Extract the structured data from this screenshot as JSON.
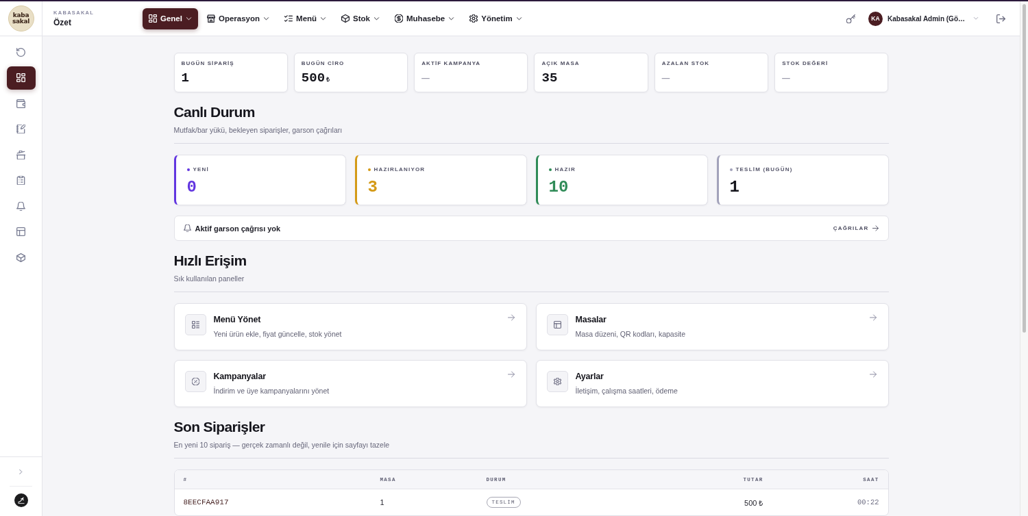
{
  "sidebar": {
    "logo": {
      "lines": [
        "kaba",
        "sakal"
      ]
    },
    "items": [
      {
        "selected": false
      },
      {
        "selected": true
      },
      {
        "selected": false
      },
      {
        "selected": false
      },
      {
        "selected": false
      },
      {
        "selected": false
      },
      {
        "selected": false
      },
      {
        "selected": false
      },
      {
        "selected": false
      }
    ]
  },
  "topbar": {
    "breadcrumb": {
      "section": "KABASAKAL",
      "page": "Özet"
    },
    "nav": [
      {
        "label": "Genel",
        "selected": true
      },
      {
        "label": "Operasyon",
        "selected": false
      },
      {
        "label": "Menü",
        "selected": false
      },
      {
        "label": "Stok",
        "selected": false
      },
      {
        "label": "Muhasebe",
        "selected": false
      },
      {
        "label": "Yönetim",
        "selected": false
      }
    ],
    "user": {
      "initials": "KA",
      "name": "Kabasakal Admin (Gö…"
    }
  },
  "stats": [
    {
      "label": "BUGÜN SİPARİŞ",
      "value": "1",
      "kind": "number"
    },
    {
      "label": "BUGÜN CİRO",
      "value": "500",
      "unit": "₺",
      "kind": "number"
    },
    {
      "label": "AKTİF KAMPANYA",
      "value": "—",
      "kind": "empty"
    },
    {
      "label": "AÇIK MASA",
      "value": "35",
      "kind": "number"
    },
    {
      "label": "AZALAN STOK",
      "value": "—",
      "kind": "empty"
    },
    {
      "label": "STOK DEĞERİ",
      "value": "—",
      "kind": "empty"
    }
  ],
  "live": {
    "title": "Canlı Durum",
    "subtitle": "Mutfak/bar yükü, bekleyen siparişler, garson çağrıları",
    "cards": [
      {
        "label": "YENİ",
        "value": "0",
        "color": "#6236e0",
        "kind": "accent"
      },
      {
        "label": "HAZIRLANIYOR",
        "value": "3",
        "color": "#d49a17",
        "kind": "accent"
      },
      {
        "label": "HAZIR",
        "value": "10",
        "color": "#2f8b57",
        "kind": "accent"
      },
      {
        "label": "TESLİM (BUGÜN)",
        "value": "1",
        "color": "#a2a2ba",
        "kind": "plain"
      }
    ],
    "waiter_calls": {
      "message": "Aktif garson çağrısı yok",
      "link": "ÇAĞRILAR"
    }
  },
  "quick_access": {
    "title": "Hızlı Erişim",
    "subtitle": "Sık kullanılan paneller",
    "cards": [
      {
        "title": "Menü Yönet",
        "description": "Yeni ürün ekle, fiyat güncelle, stok yönet"
      },
      {
        "title": "Masalar",
        "description": "Masa düzeni, QR kodları, kapasite"
      },
      {
        "title": "Kampanyalar",
        "description": "İndirim ve üye kampanyalarını yönet"
      },
      {
        "title": "Ayarlar",
        "description": "İletişim, çalışma saatleri, ödeme"
      }
    ]
  },
  "recent_orders": {
    "title": "Son Siparişler",
    "subtitle": "En yeni 10 sipariş — gerçek zamanlı değil, yenile için sayfayı tazele",
    "columns": [
      "#",
      "MASA",
      "DURUM",
      "TUTAR",
      "SAAT"
    ],
    "rows": [
      {
        "id": "8EECFAA917",
        "table": "1",
        "status": "TESLİM",
        "amount": "500 ₺",
        "time": "00:22"
      }
    ]
  }
}
